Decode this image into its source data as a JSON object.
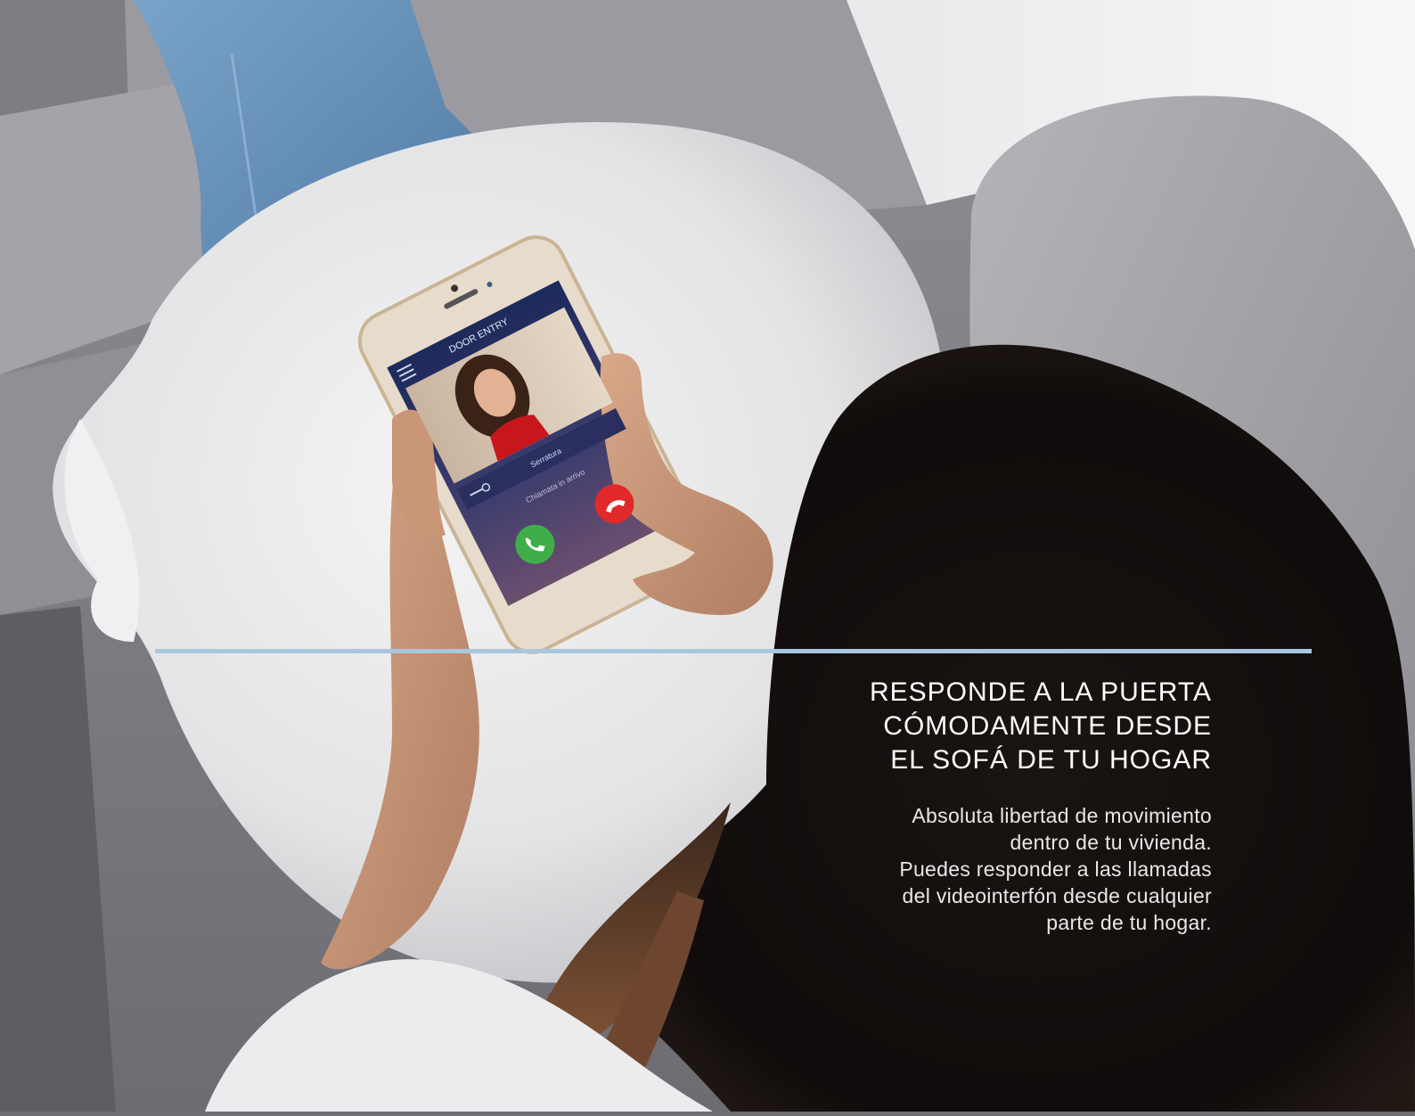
{
  "hero": {
    "headline_lines": [
      "RESPONDE A LA PUERTA",
      "CÓMODAMENTE DESDE",
      "EL SOFÁ DE TU HOGAR"
    ],
    "body_lines": [
      "Absoluta libertad de movimiento",
      "dentro de tu vivienda.",
      "Puedes responder a las llamadas",
      "del videointerfón desde cualquier",
      "parte de tu hogar."
    ]
  },
  "phone_app": {
    "title": "DOOR ENTRY",
    "door_button_label": "Serratura",
    "status_text": "Chiamata in arrivo",
    "icons": [
      "menu-icon",
      "key-icon",
      "answer-call-icon",
      "hang-up-icon"
    ]
  },
  "colors": {
    "divider": "#a9c6dc",
    "text": "#ffffff",
    "answer_button": "#3fae49",
    "hangup_button": "#e02a2a"
  }
}
